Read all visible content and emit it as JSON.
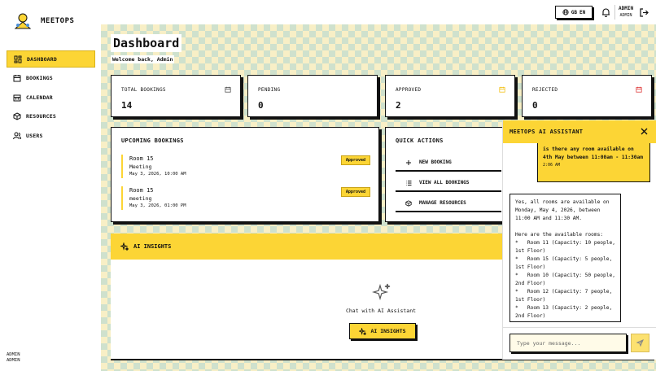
{
  "app": {
    "name": "MEETOPS"
  },
  "sidebar": {
    "items": [
      {
        "label": "DASHBOARD",
        "icon": "dashboard-icon",
        "active": true
      },
      {
        "label": "BOOKINGS",
        "icon": "calendar-icon",
        "active": false
      },
      {
        "label": "CALENDAR",
        "icon": "calendar-grid-icon",
        "active": false
      },
      {
        "label": "RESOURCES",
        "icon": "cube-icon",
        "active": false
      },
      {
        "label": "USERS",
        "icon": "users-icon",
        "active": false
      }
    ],
    "user_name": "ADMIN",
    "user_role": "ADMIN"
  },
  "header": {
    "lang_flag": "GB",
    "lang_code": "EN",
    "user_name": "ADMIN",
    "user_role": "ADMIN"
  },
  "page": {
    "title": "Dashboard",
    "welcome": "Welcome back, Admin"
  },
  "stats": [
    {
      "label": "TOTAL BOOKINGS",
      "value": "14",
      "icon": "calendar-icon",
      "icon_color": "#555555"
    },
    {
      "label": "PENDING",
      "value": "0",
      "icon": "",
      "icon_color": ""
    },
    {
      "label": "APPROVED",
      "value": "2",
      "icon": "calendar-icon",
      "icon_color": "#f2c21b"
    },
    {
      "label": "REJECTED",
      "value": "0",
      "icon": "calendar-icon",
      "icon_color": "#e04040"
    }
  ],
  "upcoming": {
    "title": "UPCOMING BOOKINGS",
    "items": [
      {
        "room": "Room 15",
        "type": "Meeting",
        "date": "May 3, 2026, 10:00 AM",
        "status": "Approved"
      },
      {
        "room": "Room 15",
        "type": "meeting",
        "date": "May 3, 2026, 01:00 PM",
        "status": "Approved"
      }
    ]
  },
  "quick_actions": {
    "title": "QUICK ACTIONS",
    "items": [
      {
        "label": "NEW BOOKING",
        "icon": "plus-icon"
      },
      {
        "label": "VIEW ALL BOOKINGS",
        "icon": "list-icon"
      },
      {
        "label": "MANAGE RESOURCES",
        "icon": "cube-icon"
      }
    ]
  },
  "insights": {
    "title": "AI INSIGHTS",
    "prompt": "Chat with AI Assistant",
    "button": "AI INSIGHTS"
  },
  "chat": {
    "title": "MEETOPS AI ASSISTANT",
    "user_message": "is there any room available on 4th May between 11:00am - 11:30am",
    "user_time": "2:06 AM",
    "ai_message": "Yes, all rooms are available on Monday, May 4, 2026, between 11:00 AM and 11:30 AM.\n\nHere are the available rooms:\n*   Room 11 (Capacity: 10 people, 1st Floor)\n*   Room 15 (Capacity: 5 people, 1st Floor)\n*   Room 10 (Capacity: 50 people, 2nd Floor)\n*   Room 12 (Capacity: 7 people, 1st Floor)\n*   Room 13 (Capacity: 2 people, 2nd Floor)",
    "placeholder": "Type your message..."
  },
  "colors": {
    "accent": "#fcd535",
    "border": "#111111"
  }
}
